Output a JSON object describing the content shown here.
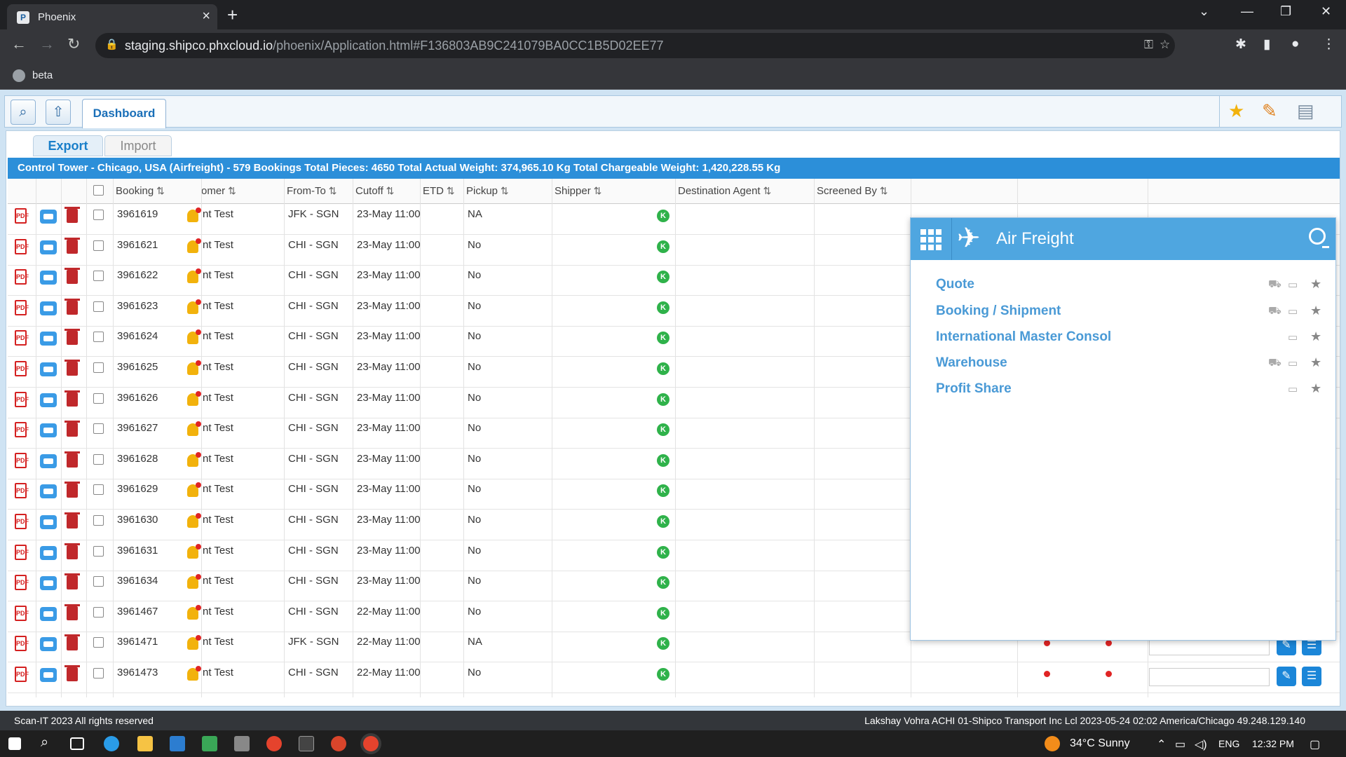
{
  "browser": {
    "tab_title": "Phoenix",
    "url_host": "staging.shipco.phxcloud.io",
    "url_path": "/phoenix/Application.html#F136803AB9C241079BA0CC1B5D02EE77",
    "bookmark": "beta"
  },
  "toolbar": {
    "dashboard_tab": "Dashboard"
  },
  "subtabs": {
    "export": "Export",
    "import": "Import"
  },
  "control_tower": "Control Tower - Chicago, USA (Airfreight) - 579 Bookings Total Pieces: 4650 Total Actual Weight: 374,965.10 Kg Total Chargeable Weight: 1,420,228.55 Kg",
  "columns": {
    "booking": "Booking",
    "customer": "omer",
    "from_to": "From-To",
    "cutoff": "Cutoff",
    "etd": "ETD",
    "pickup": "Pickup",
    "shipper": "Shipper",
    "dest_agent": "Destination Agent",
    "screened_by": "Screened By"
  },
  "rows": [
    {
      "booking": "3961619",
      "customer": "nt Test",
      "from_to": "JFK - SGN",
      "cutoff": "23-May 11:00",
      "pickup": "NA",
      "k": "K"
    },
    {
      "booking": "3961621",
      "customer": "nt Test",
      "from_to": "CHI - SGN",
      "cutoff": "23-May 11:00",
      "pickup": "No",
      "k": "K"
    },
    {
      "booking": "3961622",
      "customer": "nt Test",
      "from_to": "CHI - SGN",
      "cutoff": "23-May 11:00",
      "pickup": "No",
      "k": "K"
    },
    {
      "booking": "3961623",
      "customer": "nt Test",
      "from_to": "CHI - SGN",
      "cutoff": "23-May 11:00",
      "pickup": "No",
      "k": "K"
    },
    {
      "booking": "3961624",
      "customer": "nt Test",
      "from_to": "CHI - SGN",
      "cutoff": "23-May 11:00",
      "pickup": "No",
      "k": "K"
    },
    {
      "booking": "3961625",
      "customer": "nt Test",
      "from_to": "CHI - SGN",
      "cutoff": "23-May 11:00",
      "pickup": "No",
      "k": "K"
    },
    {
      "booking": "3961626",
      "customer": "nt Test",
      "from_to": "CHI - SGN",
      "cutoff": "23-May 11:00",
      "pickup": "No",
      "k": "K"
    },
    {
      "booking": "3961627",
      "customer": "nt Test",
      "from_to": "CHI - SGN",
      "cutoff": "23-May 11:00",
      "pickup": "No",
      "k": "K"
    },
    {
      "booking": "3961628",
      "customer": "nt Test",
      "from_to": "CHI - SGN",
      "cutoff": "23-May 11:00",
      "pickup": "No",
      "k": "K"
    },
    {
      "booking": "3961629",
      "customer": "nt Test",
      "from_to": "CHI - SGN",
      "cutoff": "23-May 11:00",
      "pickup": "No",
      "k": "K"
    },
    {
      "booking": "3961630",
      "customer": "nt Test",
      "from_to": "CHI - SGN",
      "cutoff": "23-May 11:00",
      "pickup": "No",
      "k": "K"
    },
    {
      "booking": "3961631",
      "customer": "nt Test",
      "from_to": "CHI - SGN",
      "cutoff": "23-May 11:00",
      "pickup": "No",
      "k": "K"
    },
    {
      "booking": "3961634",
      "customer": "nt Test",
      "from_to": "CHI - SGN",
      "cutoff": "23-May 11:00",
      "pickup": "No",
      "k": "K"
    },
    {
      "booking": "3961467",
      "customer": "nt Test",
      "from_to": "CHI - SGN",
      "cutoff": "22-May 11:00",
      "pickup": "No",
      "k": "K"
    },
    {
      "booking": "3961471",
      "customer": "nt Test",
      "from_to": "JFK - SGN",
      "cutoff": "22-May 11:00",
      "pickup": "NA",
      "k": "K"
    },
    {
      "booking": "3961473",
      "customer": "nt Test",
      "from_to": "CHI - SGN",
      "cutoff": "22-May 11:00",
      "pickup": "No",
      "k": "K"
    }
  ],
  "panel": {
    "title": "Air Freight",
    "items": [
      "Quote",
      "Booking / Shipment",
      "International Master Consol",
      "Warehouse",
      "Profit Share"
    ]
  },
  "footer": {
    "left": "Scan-IT 2023 All rights reserved",
    "right": "Lakshay Vohra ACHI 01-Shipco Transport Inc Lcl 2023-05-24 02:02 America/Chicago 49.248.129.140"
  },
  "taskbar": {
    "weather": "34°C Sunny",
    "lang": "ENG",
    "time": "12:32 PM"
  }
}
